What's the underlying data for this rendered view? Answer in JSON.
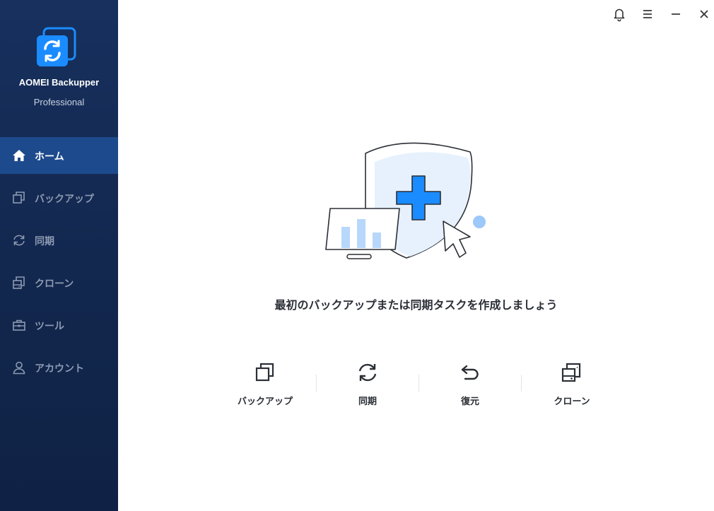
{
  "app": {
    "name": "AOMEI Backupper",
    "edition": "Professional"
  },
  "colors": {
    "sidebar_bg": "#13284f",
    "sidebar_active": "#1d4a8c",
    "accent": "#0a84ff"
  },
  "sidebar": {
    "items": [
      {
        "label": "ホーム",
        "icon": "home-icon",
        "active": true
      },
      {
        "label": "バックアップ",
        "icon": "backup-icon",
        "active": false
      },
      {
        "label": "同期",
        "icon": "sync-icon",
        "active": false
      },
      {
        "label": "クローン",
        "icon": "clone-icon",
        "active": false
      },
      {
        "label": "ツール",
        "icon": "toolbox-icon",
        "active": false
      },
      {
        "label": "アカウント",
        "icon": "user-icon",
        "active": false
      }
    ]
  },
  "titlebar": {
    "buttons": [
      "bell-icon",
      "menu-icon",
      "minimize-icon",
      "close-icon"
    ]
  },
  "main": {
    "headline": "最初のバックアップまたは同期タスクを作成しましょう",
    "actions": [
      {
        "label": "バックアップ",
        "icon": "backup-icon"
      },
      {
        "label": "同期",
        "icon": "sync-icon"
      },
      {
        "label": "復元",
        "icon": "restore-icon"
      },
      {
        "label": "クローン",
        "icon": "clone-icon"
      }
    ]
  }
}
